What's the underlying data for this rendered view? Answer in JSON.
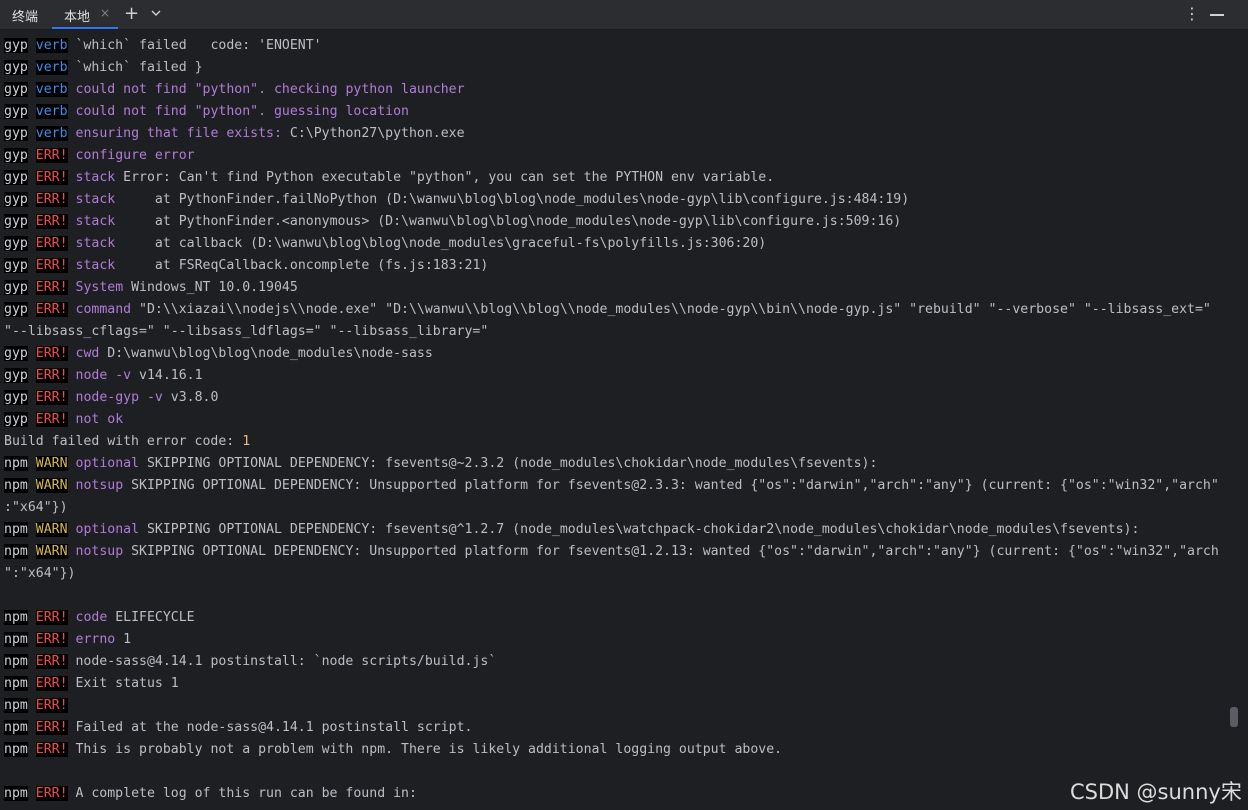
{
  "tabbar": {
    "title": "终端",
    "tab_label": "本地",
    "close_glyph": "×",
    "add_glyph": "+",
    "more_glyph": "⋮",
    "icons": [
      "close-icon",
      "plus-icon",
      "chevron-down-icon",
      "more-vertical-icon",
      "minimize-icon"
    ]
  },
  "colors": {
    "background": "#1e1f22",
    "text": "#bcbec4",
    "verb": "#3b8eea",
    "err": "#f14c4c",
    "warn": "#d7ba4b",
    "keyword": "#b07cd8",
    "number": "#e5c07b"
  },
  "lines": [
    [
      {
        "t": "gyp",
        "c": "tool"
      },
      {
        "t": " "
      },
      {
        "t": "verb",
        "c": "verb"
      },
      {
        "t": " `which` failed   code: 'ENOENT'"
      }
    ],
    [
      {
        "t": "gyp",
        "c": "tool"
      },
      {
        "t": " "
      },
      {
        "t": "verb",
        "c": "verb"
      },
      {
        "t": " `which` failed }"
      }
    ],
    [
      {
        "t": "gyp",
        "c": "tool"
      },
      {
        "t": " "
      },
      {
        "t": "verb",
        "c": "verb"
      },
      {
        "t": " "
      },
      {
        "t": "could not find \"python\". checking python launcher",
        "c": "key"
      }
    ],
    [
      {
        "t": "gyp",
        "c": "tool"
      },
      {
        "t": " "
      },
      {
        "t": "verb",
        "c": "verb"
      },
      {
        "t": " "
      },
      {
        "t": "could not find \"python\". guessing location",
        "c": "key"
      }
    ],
    [
      {
        "t": "gyp",
        "c": "tool"
      },
      {
        "t": " "
      },
      {
        "t": "verb",
        "c": "verb"
      },
      {
        "t": " "
      },
      {
        "t": "ensuring that file exists:",
        "c": "key"
      },
      {
        "t": " C:\\Python27\\python.exe"
      }
    ],
    [
      {
        "t": "gyp",
        "c": "tool"
      },
      {
        "t": " "
      },
      {
        "t": "ERR!",
        "c": "err"
      },
      {
        "t": " "
      },
      {
        "t": "configure error",
        "c": "key"
      }
    ],
    [
      {
        "t": "gyp",
        "c": "tool"
      },
      {
        "t": " "
      },
      {
        "t": "ERR!",
        "c": "err"
      },
      {
        "t": " "
      },
      {
        "t": "stack",
        "c": "key"
      },
      {
        "t": " Error: Can't find Python executable \"python\", you can set the PYTHON env variable."
      }
    ],
    [
      {
        "t": "gyp",
        "c": "tool"
      },
      {
        "t": " "
      },
      {
        "t": "ERR!",
        "c": "err"
      },
      {
        "t": " "
      },
      {
        "t": "stack",
        "c": "key"
      },
      {
        "t": "     at PythonFinder.failNoPython (D:\\wanwu\\blog\\blog\\node_modules\\node-gyp\\lib\\configure.js:484:19)"
      }
    ],
    [
      {
        "t": "gyp",
        "c": "tool"
      },
      {
        "t": " "
      },
      {
        "t": "ERR!",
        "c": "err"
      },
      {
        "t": " "
      },
      {
        "t": "stack",
        "c": "key"
      },
      {
        "t": "     at PythonFinder.<anonymous> (D:\\wanwu\\blog\\blog\\node_modules\\node-gyp\\lib\\configure.js:509:16)"
      }
    ],
    [
      {
        "t": "gyp",
        "c": "tool"
      },
      {
        "t": " "
      },
      {
        "t": "ERR!",
        "c": "err"
      },
      {
        "t": " "
      },
      {
        "t": "stack",
        "c": "key"
      },
      {
        "t": "     at callback (D:\\wanwu\\blog\\blog\\node_modules\\graceful-fs\\polyfills.js:306:20)"
      }
    ],
    [
      {
        "t": "gyp",
        "c": "tool"
      },
      {
        "t": " "
      },
      {
        "t": "ERR!",
        "c": "err"
      },
      {
        "t": " "
      },
      {
        "t": "stack",
        "c": "key"
      },
      {
        "t": "     at FSReqCallback.oncomplete (fs.js:183:21)"
      }
    ],
    [
      {
        "t": "gyp",
        "c": "tool"
      },
      {
        "t": " "
      },
      {
        "t": "ERR!",
        "c": "err"
      },
      {
        "t": " "
      },
      {
        "t": "System",
        "c": "key"
      },
      {
        "t": " Windows_NT 10.0.19045"
      }
    ],
    [
      {
        "t": "gyp",
        "c": "tool"
      },
      {
        "t": " "
      },
      {
        "t": "ERR!",
        "c": "err"
      },
      {
        "t": " "
      },
      {
        "t": "command",
        "c": "key"
      },
      {
        "t": " \"D:\\\\xiazai\\\\nodejs\\\\node.exe\" \"D:\\\\wanwu\\\\blog\\\\blog\\\\node_modules\\\\node-gyp\\\\bin\\\\node-gyp.js\" \"rebuild\" \"--verbose\" \"--libsass_ext=\""
      }
    ],
    [
      {
        "t": "\"--libsass_cflags=\" \"--libsass_ldflags=\" \"--libsass_library=\""
      }
    ],
    [
      {
        "t": "gyp",
        "c": "tool"
      },
      {
        "t": " "
      },
      {
        "t": "ERR!",
        "c": "err"
      },
      {
        "t": " "
      },
      {
        "t": "cwd",
        "c": "key"
      },
      {
        "t": " D:\\wanwu\\blog\\blog\\node_modules\\node-sass"
      }
    ],
    [
      {
        "t": "gyp",
        "c": "tool"
      },
      {
        "t": " "
      },
      {
        "t": "ERR!",
        "c": "err"
      },
      {
        "t": " "
      },
      {
        "t": "node -v",
        "c": "key"
      },
      {
        "t": " v14.16.1"
      }
    ],
    [
      {
        "t": "gyp",
        "c": "tool"
      },
      {
        "t": " "
      },
      {
        "t": "ERR!",
        "c": "err"
      },
      {
        "t": " "
      },
      {
        "t": "node-gyp -v",
        "c": "key"
      },
      {
        "t": " v3.8.0"
      }
    ],
    [
      {
        "t": "gyp",
        "c": "tool"
      },
      {
        "t": " "
      },
      {
        "t": "ERR!",
        "c": "err"
      },
      {
        "t": " "
      },
      {
        "t": "not ok",
        "c": "key"
      }
    ],
    [
      {
        "t": "Build failed with error code: "
      },
      {
        "t": "1",
        "c": "num"
      }
    ],
    [
      {
        "t": "npm",
        "c": "tool"
      },
      {
        "t": " "
      },
      {
        "t": "WARN",
        "c": "warn"
      },
      {
        "t": " "
      },
      {
        "t": "optional",
        "c": "key"
      },
      {
        "t": " SKIPPING OPTIONAL DEPENDENCY: fsevents@~2.3.2 (node_modules\\chokidar\\node_modules\\fsevents):"
      }
    ],
    [
      {
        "t": "npm",
        "c": "tool"
      },
      {
        "t": " "
      },
      {
        "t": "WARN",
        "c": "warn"
      },
      {
        "t": " "
      },
      {
        "t": "notsup",
        "c": "key"
      },
      {
        "t": " SKIPPING OPTIONAL DEPENDENCY: Unsupported platform for fsevents@2.3.3: wanted {\"os\":\"darwin\",\"arch\":\"any\"} (current: {\"os\":\"win32\",\"arch\""
      }
    ],
    [
      {
        "t": ":\"x64\"})"
      }
    ],
    [
      {
        "t": "npm",
        "c": "tool"
      },
      {
        "t": " "
      },
      {
        "t": "WARN",
        "c": "warn"
      },
      {
        "t": " "
      },
      {
        "t": "optional",
        "c": "key"
      },
      {
        "t": " SKIPPING OPTIONAL DEPENDENCY: fsevents@^1.2.7 (node_modules\\watchpack-chokidar2\\node_modules\\chokidar\\node_modules\\fsevents):"
      }
    ],
    [
      {
        "t": "npm",
        "c": "tool"
      },
      {
        "t": " "
      },
      {
        "t": "WARN",
        "c": "warn"
      },
      {
        "t": " "
      },
      {
        "t": "notsup",
        "c": "key"
      },
      {
        "t": " SKIPPING OPTIONAL DEPENDENCY: Unsupported platform for fsevents@1.2.13: wanted {\"os\":\"darwin\",\"arch\":\"any\"} (current: {\"os\":\"win32\",\"arch"
      }
    ],
    [
      {
        "t": "\":\"x64\"})"
      }
    ],
    [],
    [
      {
        "t": "npm",
        "c": "tool"
      },
      {
        "t": " "
      },
      {
        "t": "ERR!",
        "c": "err"
      },
      {
        "t": " "
      },
      {
        "t": "code",
        "c": "key"
      },
      {
        "t": " ELIFECYCLE"
      }
    ],
    [
      {
        "t": "npm",
        "c": "tool"
      },
      {
        "t": " "
      },
      {
        "t": "ERR!",
        "c": "err"
      },
      {
        "t": " "
      },
      {
        "t": "errno",
        "c": "key"
      },
      {
        "t": " 1"
      }
    ],
    [
      {
        "t": "npm",
        "c": "tool"
      },
      {
        "t": " "
      },
      {
        "t": "ERR!",
        "c": "err"
      },
      {
        "t": " node-sass@4.14.1 postinstall: `node scripts/build.js`"
      }
    ],
    [
      {
        "t": "npm",
        "c": "tool"
      },
      {
        "t": " "
      },
      {
        "t": "ERR!",
        "c": "err"
      },
      {
        "t": " Exit status 1"
      }
    ],
    [
      {
        "t": "npm",
        "c": "tool"
      },
      {
        "t": " "
      },
      {
        "t": "ERR!",
        "c": "err"
      }
    ],
    [
      {
        "t": "npm",
        "c": "tool"
      },
      {
        "t": " "
      },
      {
        "t": "ERR!",
        "c": "err"
      },
      {
        "t": " Failed at the node-sass@4.14.1 postinstall script."
      }
    ],
    [
      {
        "t": "npm",
        "c": "tool"
      },
      {
        "t": " "
      },
      {
        "t": "ERR!",
        "c": "err"
      },
      {
        "t": " This is probably not a problem with npm. There is likely additional logging output above."
      }
    ],
    [],
    [
      {
        "t": "npm",
        "c": "tool"
      },
      {
        "t": " "
      },
      {
        "t": "ERR!",
        "c": "err"
      },
      {
        "t": " A complete log of this run can be found in:"
      }
    ]
  ],
  "watermark": "CSDN @sunny宋"
}
